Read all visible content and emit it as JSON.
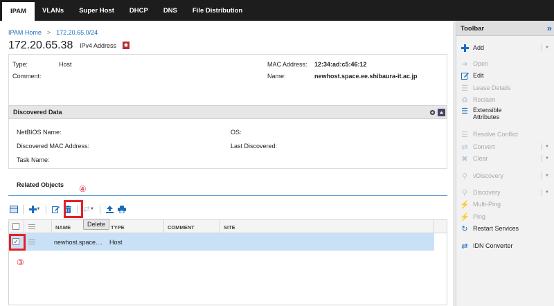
{
  "nav": {
    "tabs": [
      {
        "label": "IPAM",
        "active": true
      },
      {
        "label": "VLANs"
      },
      {
        "label": "Super Host"
      },
      {
        "label": "DHCP"
      },
      {
        "label": "DNS"
      },
      {
        "label": "File Distribution"
      }
    ]
  },
  "breadcrumb": {
    "home": "IPAM Home",
    "sep": ">",
    "current": "172.20.65.0/24"
  },
  "header": {
    "ip": "172.20.65.38",
    "type": "IPv4 Address",
    "bookmark_glyph": "✱"
  },
  "info": {
    "type_label": "Type:",
    "type_value": "Host",
    "comment_label": "Comment:",
    "mac_label": "MAC Address:",
    "mac_value": "12:34:ad:c5:46:12",
    "name_label": "Name:",
    "name_value": "newhost.space.ee.shibaura-it.ac.jp"
  },
  "discovered": {
    "title": "Discovered Data",
    "netbios": "NetBIOS Name:",
    "os": "OS:",
    "mac": "Discovered MAC Address:",
    "last": "Last Discovered:",
    "task": "Task Name:"
  },
  "related": {
    "title": "Related Objects",
    "tooltip": "Delete",
    "columns": [
      "NAME",
      "TYPE",
      "COMMENT",
      "SITE"
    ],
    "rows": [
      {
        "name": "newhost.space....",
        "type": "Host",
        "checked": true
      }
    ]
  },
  "markers": {
    "step4": "④",
    "step3": "③"
  },
  "sidebar": {
    "title": "Toolbar",
    "items": [
      {
        "label": "Add",
        "icon": "plus-icon",
        "enabled": true,
        "dropdown": true
      },
      {
        "label": "Open",
        "icon": "arrow-right-icon",
        "enabled": false
      },
      {
        "label": "Edit",
        "icon": "edit-icon",
        "enabled": true
      },
      {
        "label": "Lease Details",
        "icon": "list-icon",
        "enabled": false
      },
      {
        "label": "Reclaim",
        "icon": "recycle-icon",
        "enabled": false
      },
      {
        "label": "Extensible",
        "label2": "Attributes",
        "icon": "list-icon",
        "enabled": true
      },
      {
        "label": "Resolve Conflict",
        "icon": "list-icon",
        "enabled": false
      },
      {
        "label": "Convert",
        "icon": "swap-icon",
        "enabled": false,
        "dropdown": true
      },
      {
        "label": "Clear",
        "icon": "close-icon",
        "enabled": false,
        "dropdown": true
      },
      {
        "label": "vDiscovery",
        "icon": "search-icon",
        "enabled": false,
        "dropdown": true
      },
      {
        "label": "Discovery",
        "icon": "search-icon",
        "enabled": false,
        "dropdown": true
      },
      {
        "label": "Multi-Ping",
        "icon": "ping-icon",
        "enabled": false
      },
      {
        "label": "Ping",
        "icon": "ping-icon",
        "enabled": false
      },
      {
        "label": "Restart Services",
        "icon": "refresh-icon",
        "enabled": true
      },
      {
        "label": "IDN Converter",
        "icon": "swap-icon",
        "enabled": true
      }
    ]
  },
  "colors": {
    "accent": "#1b6cbd",
    "highlight": "#e2202a",
    "selected_row": "#c9e1f6"
  }
}
